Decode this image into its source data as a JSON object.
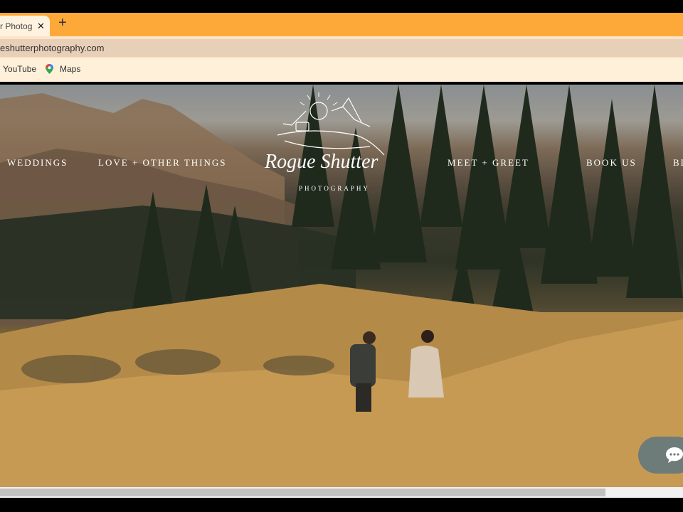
{
  "browser": {
    "tab_title": "r Photog",
    "tab_close": "✕",
    "new_tab": "+",
    "url": "eshutterphotography.com",
    "bookmarks": [
      {
        "label": "YouTube"
      },
      {
        "label": "Maps"
      }
    ]
  },
  "site": {
    "nav": [
      {
        "label": "WEDDINGS"
      },
      {
        "label": "LOVE + OTHER THINGS"
      },
      {
        "label": "MEET + GREET"
      },
      {
        "label": "BOOK US"
      },
      {
        "label": "BL"
      }
    ],
    "logo": {
      "script": "Rogue Shutter",
      "sub": "PHOTOGRAPHY"
    }
  },
  "colors": {
    "tabstrip": "#fda93a",
    "address_bg": "#fde4c6",
    "bookmarks_bg": "#fff0da",
    "chat_button": "#6d7b79"
  }
}
